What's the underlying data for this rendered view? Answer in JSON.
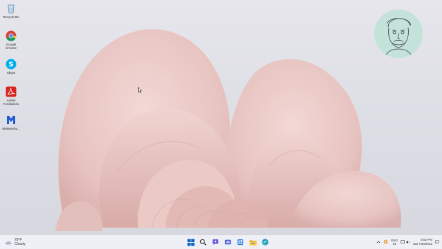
{
  "desktop": {
    "icons": [
      {
        "label": "Recycle Bin",
        "icon": "recycle-bin-icon"
      },
      {
        "label": "Google Chrome",
        "icon": "chrome-icon"
      },
      {
        "label": "Skype",
        "icon": "skype-icon"
      },
      {
        "label": "Adobe Acrobat DC",
        "icon": "acrobat-icon"
      },
      {
        "label": "Malwareby...",
        "icon": "malwarebytes-icon"
      }
    ]
  },
  "taskbar": {
    "weather": {
      "temp": "79°F",
      "condition": "Cloudy"
    },
    "apps": [
      "start-icon",
      "search-icon",
      "chat-icon",
      "task-view-icon",
      "widgets-icon",
      "file-explorer-icon",
      "edge-icon"
    ],
    "tray": {
      "lang_line1": "ENG",
      "lang_line2": "IN",
      "time": "5:52 PM",
      "date": "Sat 7/30/2022"
    }
  },
  "colors": {
    "wallpaper_petal": "#e9c9c6",
    "taskbar_bg": "#eef0f6",
    "accent": "#0a64c8"
  }
}
